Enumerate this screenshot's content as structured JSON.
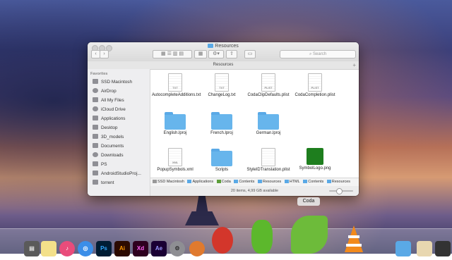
{
  "window": {
    "title": "Resources",
    "path_header": "Resources",
    "search_placeholder": "Search",
    "nav": {
      "back": "‹",
      "forward": "›"
    },
    "add_label": "+",
    "status": "20 items, 4,99 GB available"
  },
  "sidebar": {
    "heading": "Favorites",
    "items": [
      {
        "label": "SSD Macintosh"
      },
      {
        "label": "AirDrop"
      },
      {
        "label": "All My Files"
      },
      {
        "label": "iCloud Drive"
      },
      {
        "label": "Applications"
      },
      {
        "label": "Desktop"
      },
      {
        "label": "3D_models"
      },
      {
        "label": "Documents"
      },
      {
        "label": "Downloads"
      },
      {
        "label": "PS"
      },
      {
        "label": "AndroidStudioProj..."
      },
      {
        "label": "torrent"
      }
    ]
  },
  "files": [
    {
      "name": "AutocompleteAdditions.txt",
      "ext": "TXT"
    },
    {
      "name": "ChangeLog.txt",
      "ext": "TXT"
    },
    {
      "name": "CodaClipDefaults.plist",
      "ext": "PLIST"
    },
    {
      "name": "CodaCompletion.plist",
      "ext": "PLIST"
    },
    {
      "name": "English.lproj"
    },
    {
      "name": "French.lproj"
    },
    {
      "name": "German.lproj"
    },
    {
      "name": "PopupSymbols.xml",
      "ext": "XML"
    },
    {
      "name": "Scripts"
    },
    {
      "name": "StyleIDTranslation.plist"
    },
    {
      "name": "SymbolLogo.png"
    }
  ],
  "pathbar": [
    "SSD Macintosh",
    "Applications",
    "Coda",
    "Contents",
    "Resources",
    "HTML",
    "Contents",
    "Resources"
  ],
  "dock": {
    "tooltip": "Coda",
    "apps": [
      {
        "label": "Ps",
        "name": "photoshop-icon"
      },
      {
        "label": "Ai",
        "name": "illustrator-icon"
      },
      {
        "label": "Xd",
        "name": "xd-icon"
      },
      {
        "label": "Ae",
        "name": "after-effects-icon"
      }
    ]
  },
  "colors": {
    "folder": "#5aa9e6",
    "photoshop": "#001d34",
    "illustrator": "#2b0a00",
    "xd": "#2e001f",
    "after_effects": "#1a0033"
  }
}
